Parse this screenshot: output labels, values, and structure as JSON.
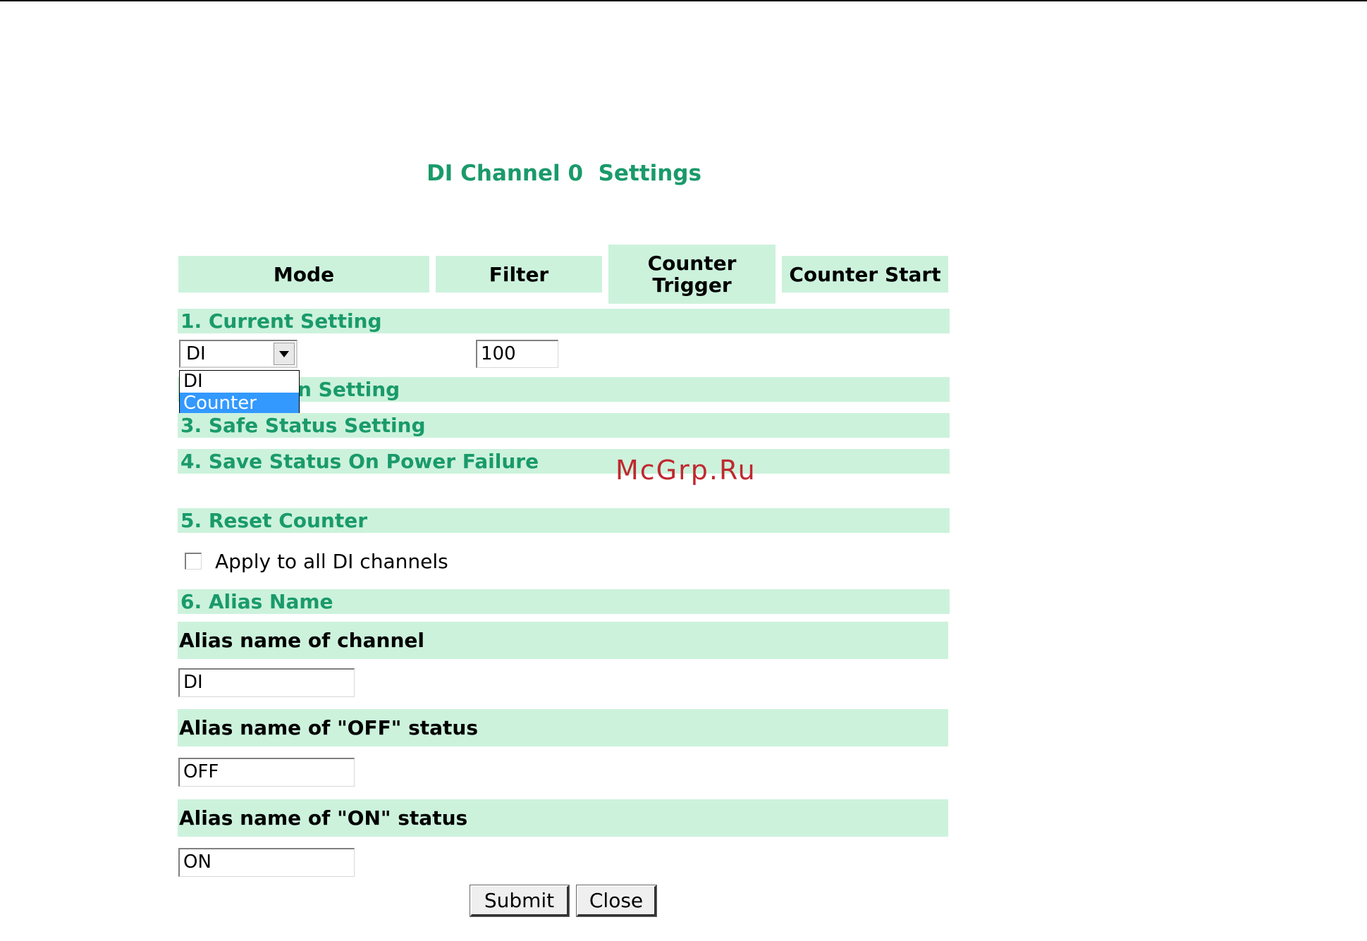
{
  "page": {
    "title": "DI Channel 0  Settings"
  },
  "columns": {
    "mode": "Mode",
    "filter": "Filter",
    "counter_trigger": "Counter Trigger",
    "counter_start": "Counter Start"
  },
  "sections": {
    "current_setting": "1. Current Setting",
    "power_on_setting_tail": "n Setting",
    "safe_status": "3. Safe Status Setting",
    "save_status": "4. Save Status On Power Failure",
    "reset_counter": "5. Reset Counter",
    "alias_name": "6. Alias Name"
  },
  "mode_select": {
    "value": "DI",
    "options": [
      "DI",
      "Counter"
    ],
    "highlighted_option": "Counter"
  },
  "filter_input": {
    "value": "100"
  },
  "apply_all": {
    "label": "Apply to all DI channels",
    "checked": false
  },
  "alias": {
    "channel_label": "Alias name of channel",
    "channel_value": "DI",
    "off_label": "Alias name of \"OFF\" status",
    "off_value": "OFF",
    "on_label": "Alias name of \"ON\" status",
    "on_value": "ON"
  },
  "buttons": {
    "submit": "Submit",
    "close": "Close"
  },
  "watermark": "McGrp.Ru",
  "colors": {
    "header_bg": "#ccf2dc",
    "accent_text": "#1a9a6a",
    "selection": "#3399ff",
    "watermark": "#c0282f"
  }
}
